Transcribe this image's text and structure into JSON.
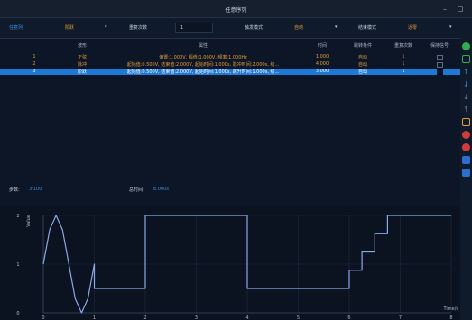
{
  "window": {
    "title": "任意序列",
    "minimize": "–",
    "maximize": "□"
  },
  "toolbar": {
    "tab": "任意列",
    "mode_value": "阶跃",
    "repeat_label": "重复次数",
    "repeat_value": "1",
    "trigger_label": "触发模式",
    "trigger_value": "自动",
    "end_label": "结束模式",
    "end_value": "近零"
  },
  "table": {
    "headers": [
      "",
      "波形",
      "属性",
      "时间",
      "跳转条件",
      "重复次数",
      "保持信号"
    ],
    "rows": [
      {
        "index": "1",
        "wave": "正弦",
        "props": "偏置:1.000V, 幅值:1.000V, 频率:1.000Hz",
        "time": "1.000",
        "jump": "自动",
        "repeat": "1",
        "checked": false,
        "selected": false
      },
      {
        "index": "2",
        "wave": "脉冲",
        "props": "起始值:0.500V, 结束值:2.000V, 起始时间:1.000s, 脉冲时间:2.000s, 结...",
        "time": "4.000",
        "jump": "自动",
        "repeat": "1",
        "checked": false,
        "selected": false
      },
      {
        "index": "3",
        "wave": "阶跃",
        "props": "起始值:0.500V, 结束值:2.000V, 起始时间:1.000s, 跳升时间:1.000s, 结...",
        "time": "3.000",
        "jump": "自动",
        "repeat": "1",
        "checked": true,
        "selected": true
      }
    ]
  },
  "stats": {
    "count_label": "步数:",
    "count_value": "3/100",
    "total_label": "总时间:",
    "total_value": "8.000s"
  },
  "chart_data": {
    "type": "line",
    "ylabel": "Value",
    "xlabel": "Time/s",
    "xlim": [
      0,
      8
    ],
    "ylim": [
      0,
      2
    ],
    "xticks": [
      "0",
      "1",
      "2",
      "3",
      "4",
      "5",
      "6",
      "7",
      "8"
    ],
    "yticks": [
      "0",
      "1",
      "2"
    ],
    "series": [
      {
        "color": "#8aa9e8",
        "x": [
          0,
          0.125,
          0.25,
          0.375,
          0.5,
          0.625,
          0.75,
          0.875,
          1.0,
          1.0,
          2.0,
          2.0,
          4.0,
          4.0,
          6.0,
          6.0,
          6.25,
          6.25,
          6.5,
          6.5,
          6.75,
          6.75,
          7.0,
          7.0,
          8.0
        ],
        "y": [
          1.0,
          1.71,
          2.0,
          1.71,
          1.0,
          0.29,
          0.0,
          0.29,
          1.0,
          0.5,
          0.5,
          2.0,
          2.0,
          0.5,
          0.5,
          0.875,
          0.875,
          1.25,
          1.25,
          1.625,
          1.625,
          2.0,
          2.0,
          2.0,
          2.0
        ]
      }
    ]
  },
  "sidebar_icons": [
    "add-icon",
    "checkbox-icon",
    "move-up-icon",
    "move-down-icon",
    "import-icon",
    "delete-icon",
    "clear-icon",
    "save-icon",
    "load-icon"
  ],
  "colors": {
    "accent": "#1c79d5",
    "orange": "#e39c35",
    "trace": "#8aa9e8",
    "bg": "#0f1a2b"
  }
}
